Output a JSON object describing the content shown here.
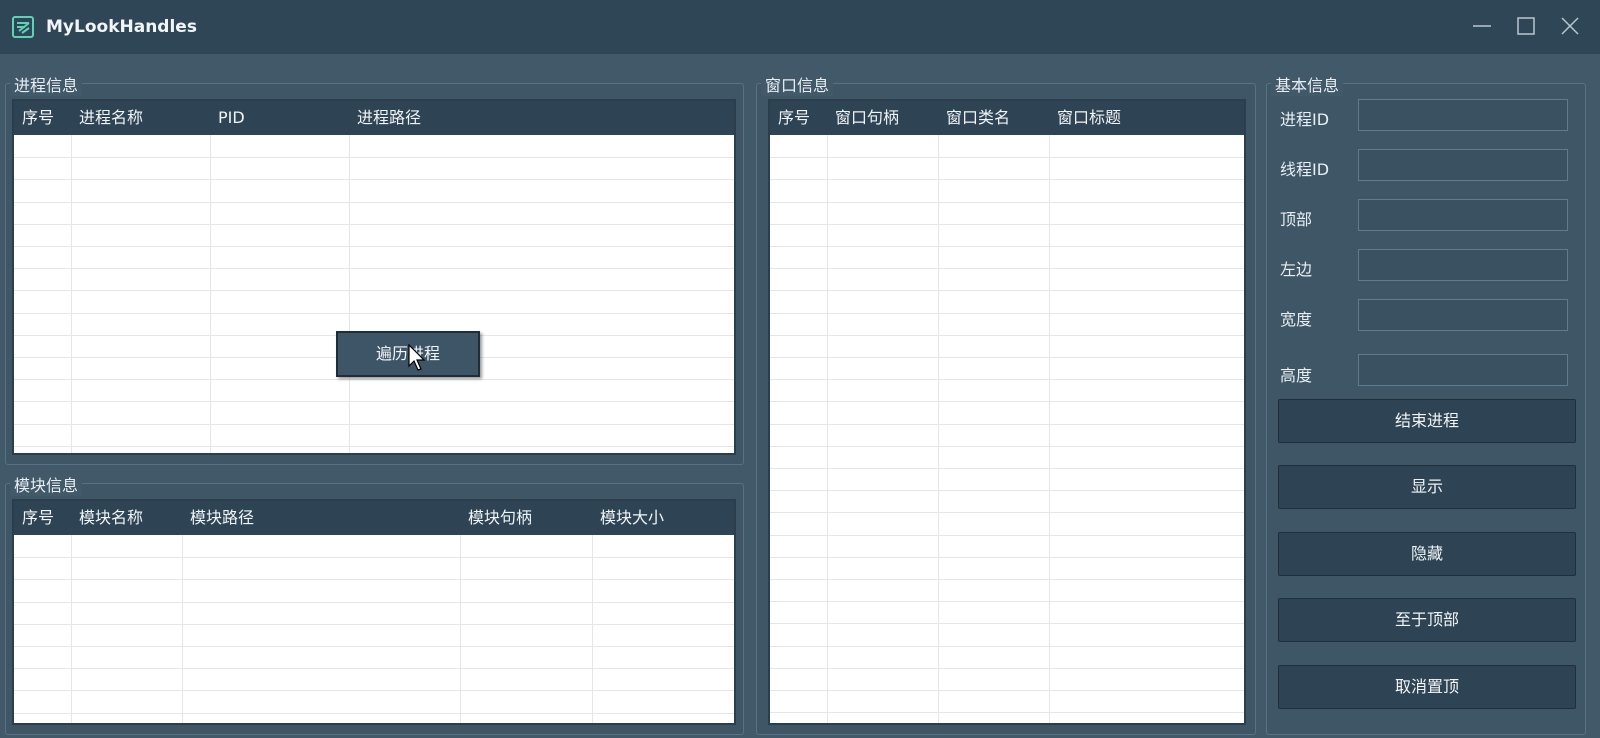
{
  "window": {
    "title": "MyLookHandles"
  },
  "process_group": {
    "title": "进程信息",
    "columns": [
      "序号",
      "进程名称",
      "PID",
      "进程路径"
    ],
    "context_button": "遍历进程"
  },
  "module_group": {
    "title": "模块信息",
    "columns": [
      "序号",
      "模块名称",
      "模块路径",
      "模块句柄",
      "模块大小"
    ]
  },
  "window_group": {
    "title": "窗口信息",
    "columns": [
      "序号",
      "窗口句柄",
      "窗口类名",
      "窗口标题"
    ]
  },
  "basic_group": {
    "title": "基本信息",
    "fields": [
      {
        "label": "进程ID",
        "value": ""
      },
      {
        "label": "线程ID",
        "value": ""
      },
      {
        "label": "顶部",
        "value": ""
      },
      {
        "label": "左边",
        "value": ""
      },
      {
        "label": "宽度",
        "value": ""
      },
      {
        "label": "高度",
        "value": ""
      }
    ],
    "buttons": [
      "结束进程",
      "显示",
      "隐藏",
      "至于顶部",
      "取消置顶"
    ]
  },
  "icons": {
    "app": "app-logo-icon",
    "minimize": "minimize-icon",
    "maximize": "maximize-icon",
    "close": "close-icon",
    "cursor": "mouse-cursor-icon"
  },
  "colors": {
    "titlebar": "#2f4657",
    "background": "#42596a",
    "header": "#2e4354",
    "accent_logo": "#5ed1b6"
  }
}
